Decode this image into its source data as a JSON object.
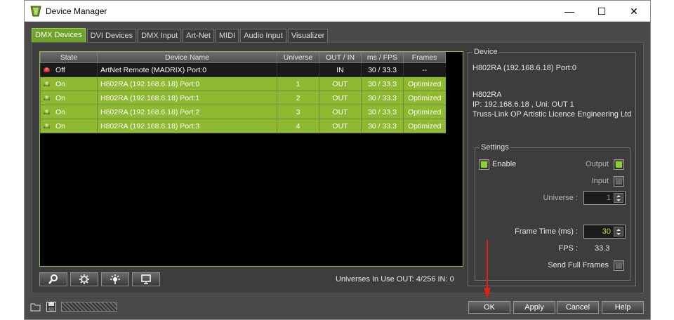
{
  "window": {
    "title": "Device Manager",
    "minimize": "—",
    "maximize": "☐",
    "close": "✕"
  },
  "tabs": [
    "DMX Devices",
    "DVI Devices",
    "DMX Input",
    "Art-Net",
    "MIDI",
    "Audio Input",
    "Visualizer"
  ],
  "active_tab": "DMX Devices",
  "table": {
    "columns": [
      "State",
      "Device Name",
      "Universe",
      "OUT / IN",
      "ms / FPS",
      "Frames"
    ],
    "rows": [
      {
        "state": "Off",
        "name": "ArtNet Remote (MADRIX) Port:0",
        "universe": "",
        "direction": "IN",
        "ms_fps": "30 / 33.3",
        "frames": "--"
      },
      {
        "state": "On",
        "name": "H802RA (192.168.6.18) Port:0",
        "universe": "1",
        "direction": "OUT",
        "ms_fps": "30 / 33.3",
        "frames": "Optimized"
      },
      {
        "state": "On",
        "name": "H802RA (192.168.6.18) Port:1",
        "universe": "2",
        "direction": "OUT",
        "ms_fps": "30 / 33.3",
        "frames": "Optimized"
      },
      {
        "state": "On",
        "name": "H802RA (192.168.6.18) Port:2",
        "universe": "3",
        "direction": "OUT",
        "ms_fps": "30 / 33.3",
        "frames": "Optimized"
      },
      {
        "state": "On",
        "name": "H802RA (192.168.6.18) Port:3",
        "universe": "4",
        "direction": "OUT",
        "ms_fps": "30 / 33.3",
        "frames": "Optimized"
      }
    ]
  },
  "toolbar_icons": [
    "search-icon",
    "settings-icon",
    "identify-icon",
    "monitor-icon"
  ],
  "universes_in_use": "Universes In Use OUT: 4/256  IN: 0",
  "device": {
    "legend": "Device",
    "selected": "H802RA (192.168.6.18) Port:0",
    "model": "H802RA",
    "ip_line": "IP: 192.168.6.18 , Uni: OUT 1",
    "manufacturer": "Truss-Link OP Artistic Licence Engineering Ltd"
  },
  "settings": {
    "legend": "Settings",
    "enable_label": "Enable",
    "enable": true,
    "output_label": "Output",
    "output": true,
    "input_label": "Input",
    "input": false,
    "universe_label": "Universe :",
    "universe_value": "1",
    "frame_time_label": "Frame Time (ms) :",
    "frame_time_value": "30",
    "fps_label": "FPS :",
    "fps_value": "33.3",
    "send_full_frames_label": "Send Full Frames",
    "send_full_frames": false
  },
  "buttons": {
    "ok": "OK",
    "apply": "Apply",
    "cancel": "Cancel",
    "help": "Help"
  },
  "colors": {
    "accent": "#8fb930",
    "active_tab": "#6fa32a",
    "arrow": "#e0201a"
  }
}
